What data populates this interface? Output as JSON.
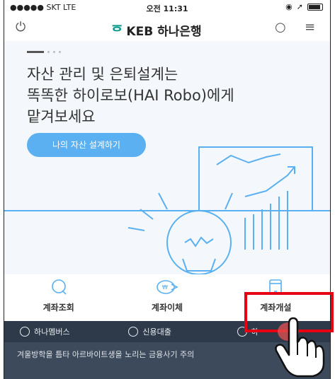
{
  "status_bar": {
    "carrier": "●●●●● SKT  LTE",
    "time": "오전 11:31"
  },
  "nav": {
    "brand": "KEB 하나은행",
    "icons": [
      "power-icon",
      "search-icon",
      "menu-icon"
    ]
  },
  "hero": {
    "headline": "자산 관리 및 은퇴설계는\n똑똑한 하이로보(HAI Robo)에게\n맡겨보세요",
    "cta_label": "나의 자산 설계하기"
  },
  "quick_menu": [
    {
      "label": "계좌조회",
      "icon": "search-circle-icon"
    },
    {
      "label": "계좌이체",
      "icon": "transfer-icon"
    },
    {
      "label": "계좌개설",
      "icon": "tablet-icon"
    }
  ],
  "bottom_menu": [
    {
      "label": "하나멤버스",
      "icon": "members-icon"
    },
    {
      "label": "신용대출",
      "icon": "loan-icon"
    },
    {
      "label": "하",
      "icon": "chat-icon"
    }
  ],
  "notice": "겨울방학을 틈타 아르바이트생을 노리는 금융사기 주의",
  "colors": {
    "accent": "#5ab0f0",
    "brand": "#0b9b8a",
    "highlight": "#e60012",
    "bottom_bar": "#2e3a4a"
  }
}
